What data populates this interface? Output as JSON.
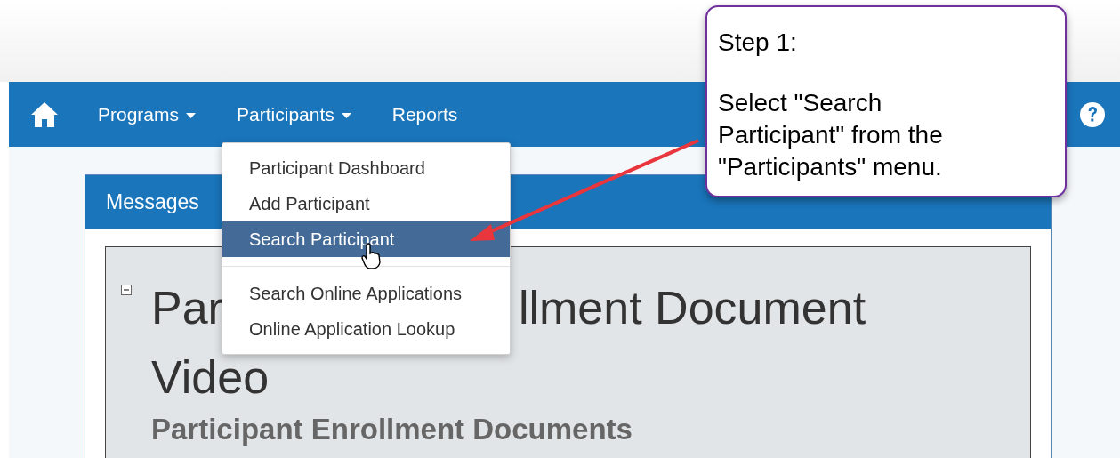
{
  "nav": {
    "items": [
      {
        "label": "Programs",
        "dropdown": true
      },
      {
        "label": "Participants",
        "dropdown": true
      },
      {
        "label": "Reports",
        "dropdown": false
      }
    ]
  },
  "menu": {
    "groups": [
      [
        {
          "label": "Participant Dashboard",
          "selected": false
        },
        {
          "label": "Add Participant",
          "selected": false
        },
        {
          "label": "Search Participant",
          "selected": true
        }
      ],
      [
        {
          "label": "Search Online Applications",
          "selected": false
        },
        {
          "label": "Online Application Lookup",
          "selected": false
        }
      ]
    ]
  },
  "messages": {
    "title": "Messages",
    "heading_parts": [
      "Par",
      "llment Document",
      "Video"
    ],
    "subheading": "Participant Enrollment Documents"
  },
  "callout": {
    "lines": [
      "Step 1:",
      "Select \"Search Participant\" from the \"Participants\" menu."
    ]
  }
}
